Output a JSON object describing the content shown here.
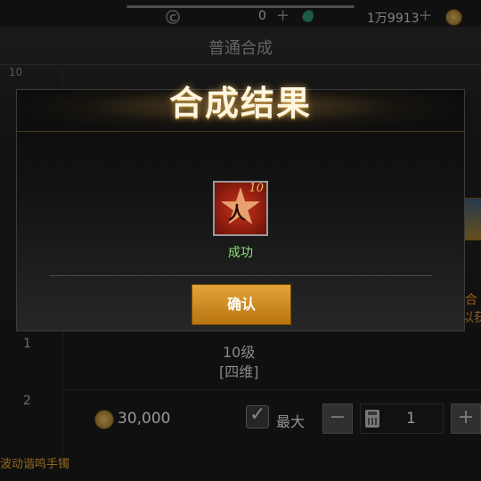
{
  "topbar": {
    "currency1_value": "0",
    "currency2_value": "1万9913",
    "plus": "+"
  },
  "screen": {
    "title": "普通合成",
    "side_top_number": "10",
    "side_items": [
      "1",
      "2"
    ]
  },
  "item": {
    "level": "10级",
    "attribute": "[四维]"
  },
  "controls": {
    "cost": "30,000",
    "max_label": "最大",
    "minus": "−",
    "quantity": "1",
    "plus": "+"
  },
  "right_clipped": {
    "line1": "合",
    "line2": "以获"
  },
  "bottom_text": "波动谐鸣手镯",
  "modal": {
    "title": "合成结果",
    "item_level_badge": "10",
    "result": "成功",
    "confirm_label": "确认"
  },
  "colors": {
    "accent_gold": "#c88a1e",
    "success_green": "#8ee07a",
    "warning_orange": "#e09030"
  }
}
